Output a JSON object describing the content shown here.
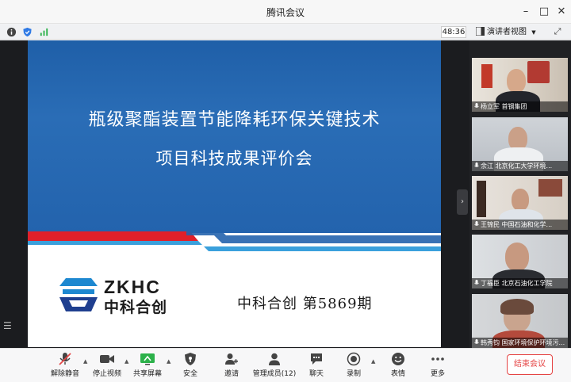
{
  "window": {
    "title": "腾讯会议"
  },
  "infobar": {
    "timer": "48:36",
    "view_label": "演讲者视图"
  },
  "slide": {
    "title_line1": "瓶级聚酯装置节能降耗环保关键技术",
    "title_line2": "项目科技成果评价会",
    "logo_en": "ZKHC",
    "logo_cn": "中科合创",
    "issue": "中科合创  第5869期"
  },
  "participants": [
    {
      "caption": "杨立军 首钢集团"
    },
    {
      "caption": "余江 北京化工大学环境..."
    },
    {
      "caption": "王锦民 中国石油和化学..."
    },
    {
      "caption": "丁福臣 北京石油化工学院"
    },
    {
      "caption": "韩秀钧 国家环境保护环境污..."
    }
  ],
  "toolbar": {
    "unmute": "解除静音",
    "stop_video": "停止视频",
    "share_screen": "共享屏幕",
    "security": "安全",
    "invite": "邀请",
    "manage_members": "管理成员(12)",
    "chat": "聊天",
    "record": "录制",
    "emoji": "表情",
    "more": "更多",
    "end_meeting": "结束会议"
  },
  "colors": {
    "brand_blue": "#2363ad",
    "accent_red": "#e54545",
    "slide_red": "#e0202a",
    "slide_cyan": "#3aa0dc"
  }
}
